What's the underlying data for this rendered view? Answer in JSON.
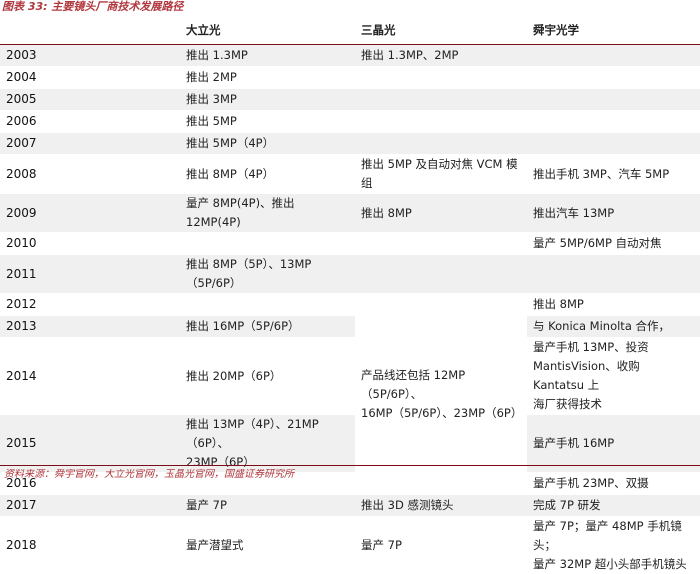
{
  "caption": "图表 33: 主要镜头厂商技术发展路径",
  "headers": [
    "",
    "大立光",
    "三晶光",
    "舜宇光学"
  ],
  "rows": {
    "r2003": {
      "year": "2003",
      "dali": "推出 1.3MP",
      "sanjing": "推出 1.3MP、2MP",
      "shunyu": ""
    },
    "r2004": {
      "year": "2004",
      "dali": "推出 2MP",
      "sanjing": "",
      "shunyu": ""
    },
    "r2005": {
      "year": "2005",
      "dali": "推出 3MP",
      "sanjing": "",
      "shunyu": ""
    },
    "r2006": {
      "year": "2006",
      "dali": "推出 5MP",
      "sanjing": "",
      "shunyu": ""
    },
    "r2007": {
      "year": "2007",
      "dali": "推出 5MP（4P）",
      "sanjing": "",
      "shunyu": ""
    },
    "r2008": {
      "year": "2008",
      "dali": "推出 8MP（4P）",
      "sanjing": "推出 5MP 及自动对焦 VCM 模组",
      "shunyu": "推出手机 3MP、汽车 5MP"
    },
    "r2009": {
      "year": "2009",
      "dali": "量产 8MP(4P)、推出 12MP(4P)",
      "sanjing": "推出 8MP",
      "shunyu": "推出汽车 13MP"
    },
    "r2010": {
      "year": "2010",
      "dali": "",
      "sanjing": "",
      "shunyu": "量产 5MP/6MP 自动对焦"
    },
    "r2011": {
      "year": "2011",
      "dali": "推出 8MP（5P）、13MP（5P/6P）",
      "sanjing": "",
      "shunyu": ""
    },
    "r2012": {
      "year": "2012",
      "dali": "",
      "shunyu": "推出 8MP"
    },
    "r2013": {
      "year": "2013",
      "dali": "推出 16MP（5P/6P）",
      "shunyu": "与 Konica Minolta 合作，"
    },
    "r2014": {
      "year": "2014",
      "dali": "推出 20MP（6P）",
      "shunyu_l1": "量产手机 13MP、投资",
      "shunyu_l2": "MantisVision、收购 Kantatsu 上",
      "shunyu_l3": "海厂获得技术"
    },
    "r2015": {
      "year": "2015",
      "dali_l1": "推出 13MP（4P）、21MP（6P）、",
      "dali_l2": "23MP（6P）",
      "shunyu": "量产手机 16MP"
    },
    "r2016": {
      "year": "2016",
      "dali": "",
      "shunyu": "量产手机 23MP、双摄"
    },
    "r2017": {
      "year": "2017",
      "dali": "量产 7P",
      "sanjing": "推出 3D 感测镜头",
      "shunyu": "完成 7P 研发"
    },
    "r2018": {
      "year": "2018",
      "dali": "量产潜望式",
      "sanjing": "量产 7P",
      "shunyu_l1": "量产 7P；量产 48MP 手机镜头；",
      "shunyu_l2": "量产 32MP 超小头部手机镜头"
    }
  },
  "sanjing_merged_l1": "产品线还包括 12MP（5P/6P）、",
  "sanjing_merged_l2": "16MP（5P/6P）、23MP（6P）",
  "source": "资料来源：舜宇官网，大立光官网，玉晶光官网，国盛证券研究所"
}
